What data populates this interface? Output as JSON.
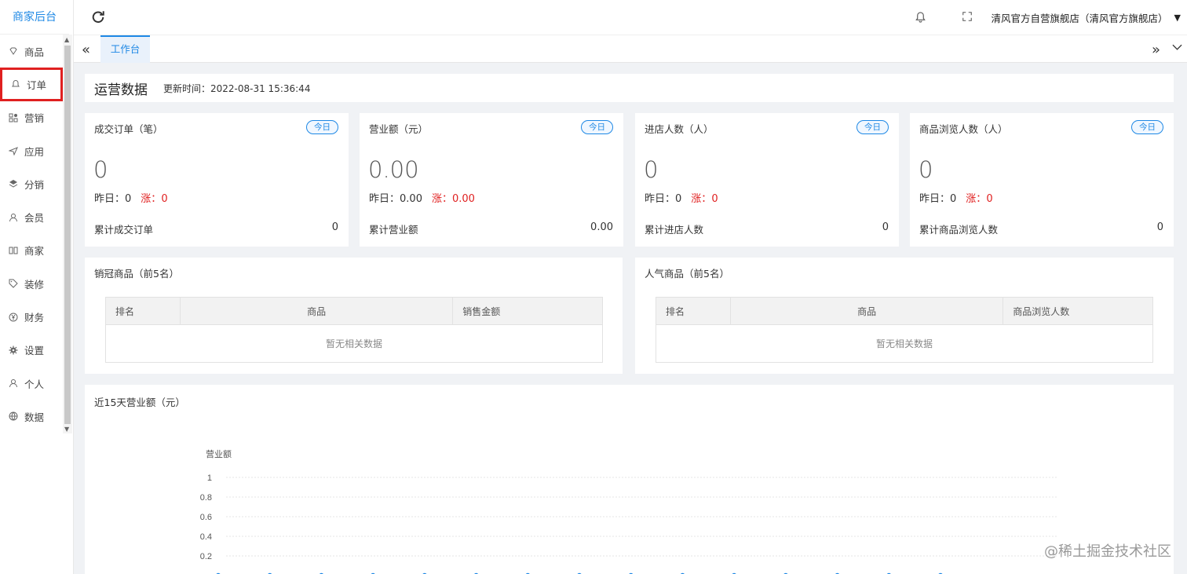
{
  "sidebar": {
    "brand": "商家后台",
    "items": [
      {
        "label": "商品",
        "icon": "diamond-icon"
      },
      {
        "label": "订单",
        "icon": "bell-icon",
        "active": true
      },
      {
        "label": "营销",
        "icon": "grid-icon"
      },
      {
        "label": "应用",
        "icon": "send-icon"
      },
      {
        "label": "分销",
        "icon": "layers-icon"
      },
      {
        "label": "会员",
        "icon": "user-icon"
      },
      {
        "label": "商家",
        "icon": "book-icon"
      },
      {
        "label": "装修",
        "icon": "tag-icon"
      },
      {
        "label": "财务",
        "icon": "yen-icon"
      },
      {
        "label": "设置",
        "icon": "gear-icon"
      },
      {
        "label": "个人",
        "icon": "person-icon"
      },
      {
        "label": "数据",
        "icon": "globe-icon"
      }
    ]
  },
  "header": {
    "store_name": "清风官方自营旗舰店（清风官方旗舰店）"
  },
  "tabs": {
    "active": "工作台"
  },
  "ops": {
    "title": "运营数据",
    "updated": "更新时间：2022-08-31 15:36:44"
  },
  "stats": [
    {
      "title": "成交订单（笔）",
      "badge": "今日",
      "value": "0",
      "yesterday_label": "昨日：",
      "yesterday": "0",
      "change_label": "涨：",
      "change": "0",
      "cum_label": "累计成交订单",
      "cum": "0"
    },
    {
      "title": "营业额（元）",
      "badge": "今日",
      "value": "0.00",
      "yesterday_label": "昨日：",
      "yesterday": "0.00",
      "change_label": "涨：",
      "change": "0.00",
      "cum_label": "累计营业额",
      "cum": "0.00"
    },
    {
      "title": "进店人数（人）",
      "badge": "今日",
      "value": "0",
      "yesterday_label": "昨日：",
      "yesterday": "0",
      "change_label": "涨：",
      "change": "0",
      "cum_label": "累计进店人数",
      "cum": "0"
    },
    {
      "title": "商品浏览人数（人）",
      "badge": "今日",
      "value": "0",
      "yesterday_label": "昨日：",
      "yesterday": "0",
      "change_label": "涨：",
      "change": "0",
      "cum_label": "累计商品浏览人数",
      "cum": "0"
    }
  ],
  "top_sales": {
    "title": "销冠商品（前5名）",
    "columns": [
      "排名",
      "商品",
      "销售金额"
    ],
    "empty": "暂无相关数据"
  },
  "top_popular": {
    "title": "人气商品（前5名）",
    "columns": [
      "排名",
      "商品",
      "商品浏览人数"
    ],
    "empty": "暂无相关数据"
  },
  "chart_data": {
    "type": "line",
    "title": "近15天营业额（元）",
    "ylabel": "营业额",
    "yticks": [
      "1",
      "0.8",
      "0.6",
      "0.4",
      "0.2"
    ],
    "ylim": [
      0,
      1
    ],
    "values": [
      0,
      0,
      0,
      0,
      0,
      0,
      0,
      0,
      0,
      0,
      0,
      0,
      0,
      0,
      0
    ],
    "series_color": "#1e88e5",
    "grid": true
  },
  "watermark": "@稀土掘金技术社区",
  "colors": {
    "accent": "#1e88e5",
    "alert": "#e02020"
  }
}
